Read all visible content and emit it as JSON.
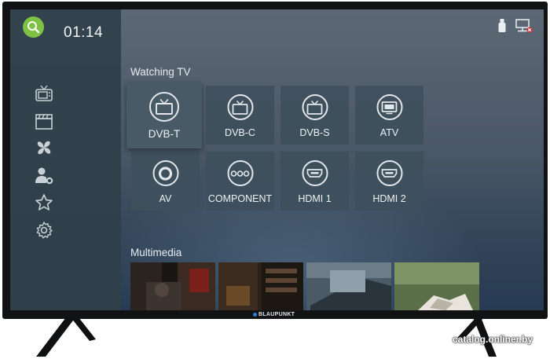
{
  "header": {
    "clock": "01:14"
  },
  "sidebar": {
    "items": [
      {
        "icon": "tv-icon"
      },
      {
        "icon": "clapperboard-icon"
      },
      {
        "icon": "apps-icon"
      },
      {
        "icon": "user-settings-icon"
      },
      {
        "icon": "star-icon"
      },
      {
        "icon": "gear-icon"
      }
    ]
  },
  "status": {
    "icons": [
      "usb-drive-icon",
      "network-disconnected-icon"
    ]
  },
  "watching_tv": {
    "title": "Watching TV",
    "sources": [
      {
        "label": "DVB-T",
        "icon": "tv-icon",
        "selected": true
      },
      {
        "label": "DVB-C",
        "icon": "tv-icon"
      },
      {
        "label": "DVB-S",
        "icon": "tv-icon"
      },
      {
        "label": "ATV",
        "icon": "monitor-icon"
      },
      {
        "label": "AV",
        "icon": "av-jack-icon"
      },
      {
        "label": "COMPONENT",
        "icon": "component-icon"
      },
      {
        "label": "HDMI 1",
        "icon": "hdmi-icon"
      },
      {
        "label": "HDMI 2",
        "icon": "hdmi-icon"
      }
    ]
  },
  "multimedia": {
    "title": "Multimedia"
  },
  "brand": {
    "name": "BLAUPUNKT"
  },
  "watermark": {
    "text": "catalog.onliner.by"
  },
  "colors": {
    "accent": "#7dc243",
    "brand_dot": "#2f7fd6"
  }
}
